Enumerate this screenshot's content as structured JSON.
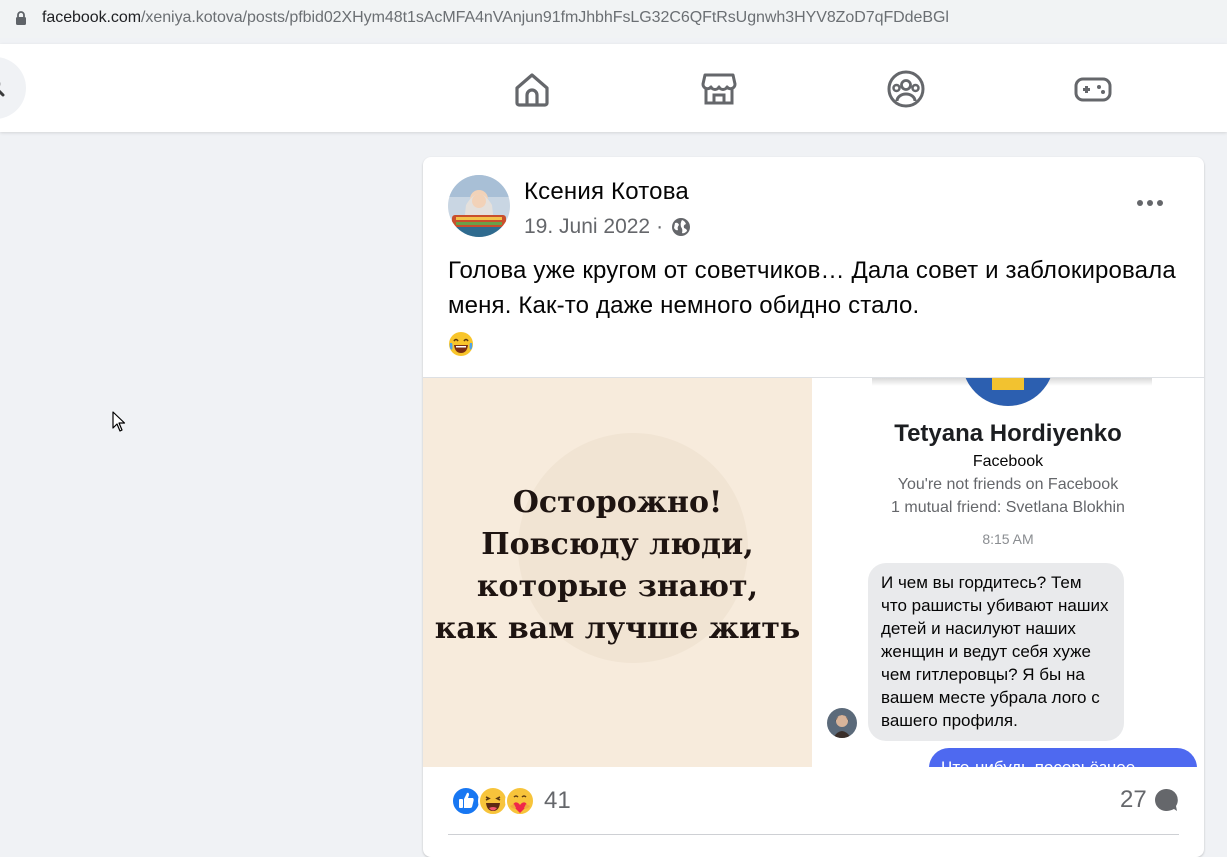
{
  "browser": {
    "url_host": "facebook.com",
    "url_path": "/xeniya.kotova/posts/pfbid02XHym48t1sAcMFA4nVAnjun91fmJhbhFsLG32C6QFtRsUgnwh3HYV8ZoD7qFDdeBGl"
  },
  "nav": {
    "icons": [
      "home-icon",
      "marketplace-icon",
      "groups-icon",
      "gaming-icon"
    ]
  },
  "post": {
    "author": "Ксения Котова",
    "date": "19. Juni 2022",
    "separator": "·",
    "privacy_icon": "globe-icon",
    "text": "Голова уже кругом от советчиков… Дала совет и заблокировала меня. Как-то даже немного обидно стало.",
    "text_emoji": "😂",
    "image": {
      "quote_lines": [
        "Осторожно!",
        "Повсюду люди,",
        "которые знают,",
        "как вам лучше жить"
      ],
      "profile_name": "Tetyana Hordiyenko",
      "profile_subtitle": "Facebook",
      "not_friends": "You're not friends on Facebook",
      "mutual": "1 mutual friend: Svetlana Blokhin",
      "time": "8:15 AM",
      "message": "И чем вы гордитесь? Тем что рашисты убивают наших детей и насилуют наших женщин и ведут себя хуже чем гитлеровцы? Я бы на вашем месте убрала лого с вашего профиля.",
      "reply_partial": "Что-нибудь посерьёзнее"
    },
    "reactions": {
      "types": [
        "like",
        "haha",
        "care"
      ],
      "count": "41"
    },
    "comments_count": "27"
  }
}
